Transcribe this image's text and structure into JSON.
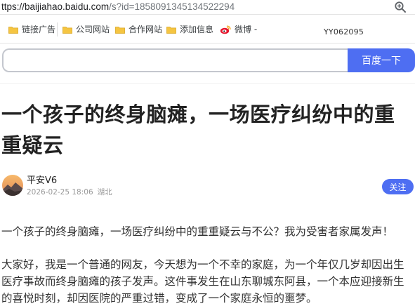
{
  "browser": {
    "url_host": "ttps://baijiahao.baidu.com",
    "url_rest": "/s?id=1858091345134522294",
    "zoom_icon": "magnifier-zoom-icon"
  },
  "bookmarks": {
    "items": [
      {
        "label": "链接广告",
        "icon": "folder-icon"
      },
      {
        "label": "公司网站",
        "icon": "folder-icon"
      },
      {
        "label": "合作网站",
        "icon": "folder-icon"
      },
      {
        "label": "添加信息",
        "icon": "folder-icon"
      },
      {
        "label": "微博 -",
        "icon": "weibo-icon"
      }
    ],
    "watermark_code": "YY062095"
  },
  "search": {
    "value": "",
    "button_label": "百度一下"
  },
  "article": {
    "title": "一个孩子的终身脑瘫，一场医疗纠纷中的重重疑云",
    "author": {
      "name": "平安V6",
      "datetime": "2026-02-25 18:06",
      "location": "湖北",
      "follow_label": "关注"
    },
    "paragraphs": [
      "一个孩子的终身脑瘫，一场医疗纠纷中的重重疑云与不公？我为受害者家属发声！",
      "大家好，我是一个普通的网友，今天想为一个不幸的家庭，为一个年仅几岁却因出生医疗事故而终身脑瘫的孩子发声。这件事发生在山东聊城东阿县，一个本应迎接新生的喜悦时刻，却因医院的严重过错，变成了一个家庭永恒的噩梦。"
    ]
  },
  "colors": {
    "accent": "#4e6ef2",
    "folder": "#f5c542",
    "weibo": "#e6162d"
  }
}
